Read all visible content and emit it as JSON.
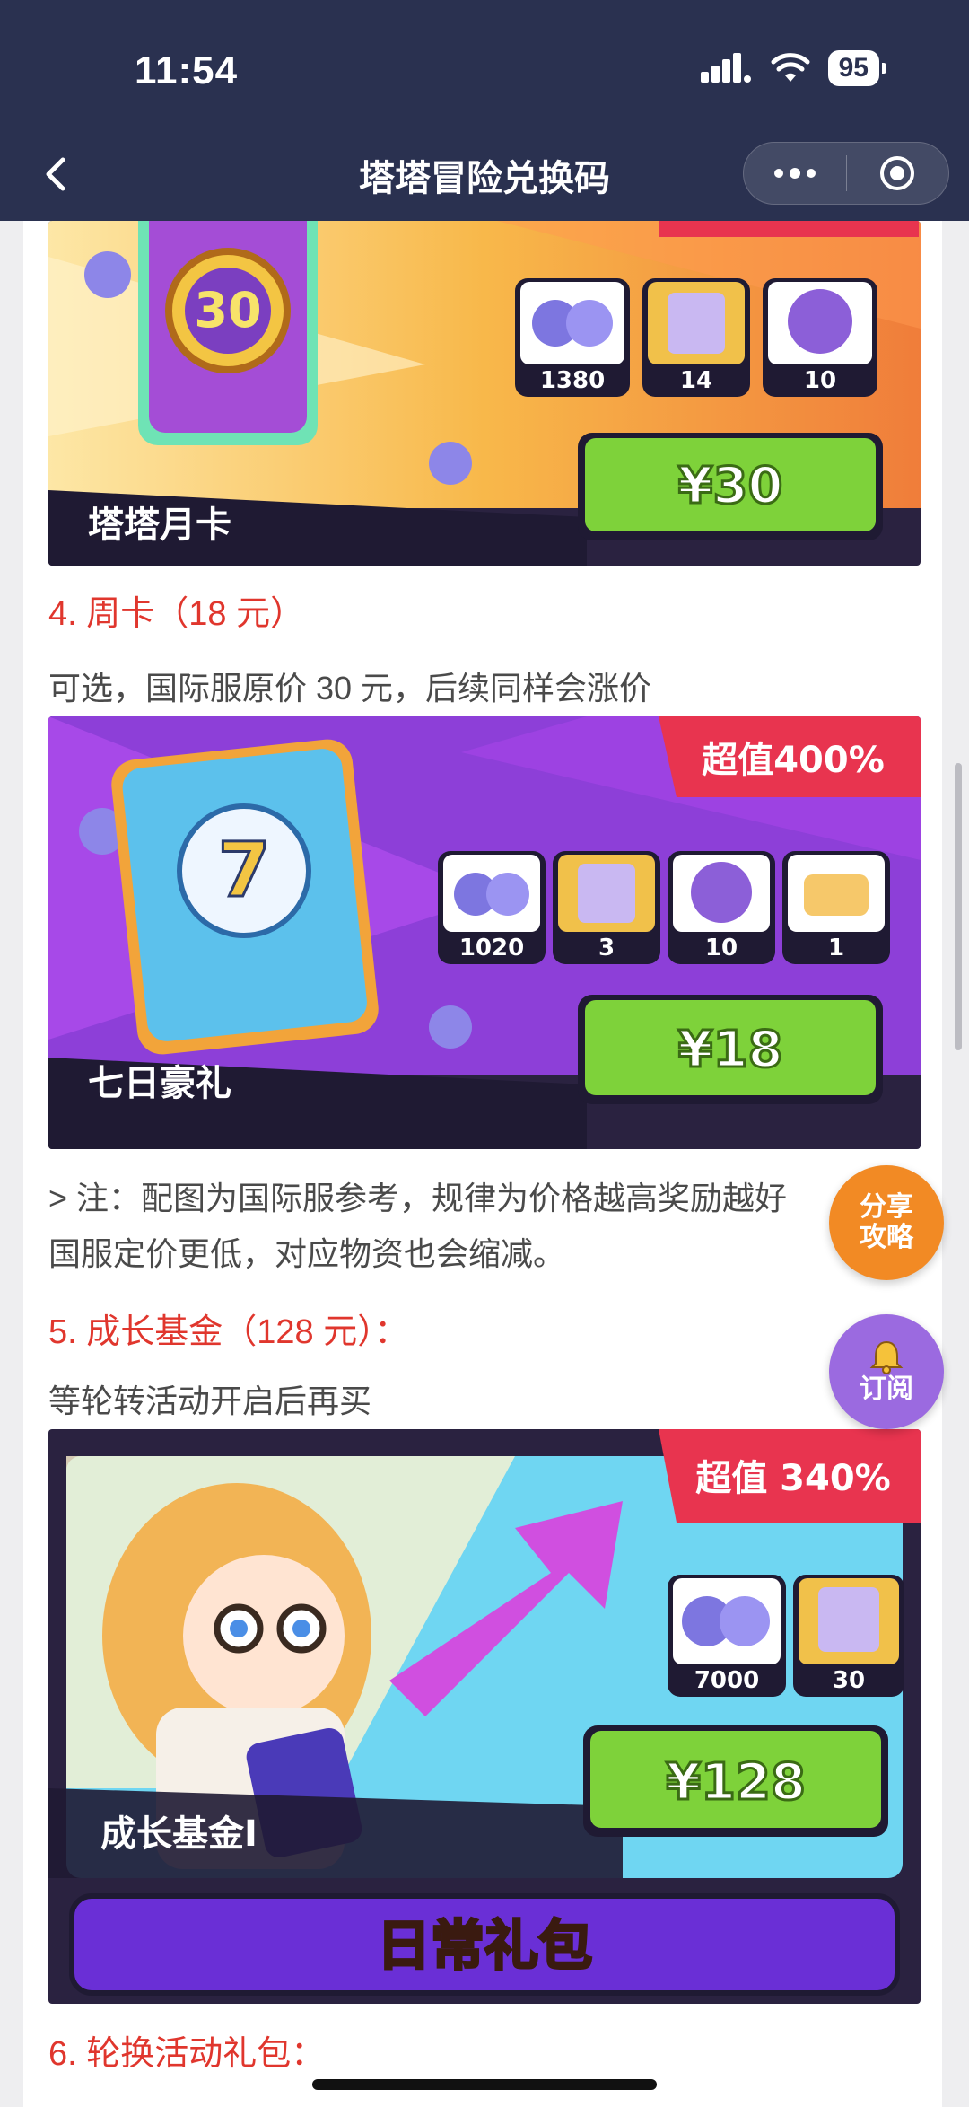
{
  "status_bar": {
    "time": "11:54",
    "battery": "95"
  },
  "nav": {
    "title": "塔塔冒险兑换码"
  },
  "banners": {
    "monthly": {
      "card_number": "30",
      "name": "塔塔月卡",
      "price": "¥30",
      "items": [
        "1380",
        "14",
        "10"
      ]
    },
    "weekly": {
      "badge": "超值400%",
      "card_number": "7",
      "name": "七日豪礼",
      "price": "¥18",
      "items": [
        "1020",
        "3",
        "10",
        "1"
      ]
    },
    "growth": {
      "badge": "超值 340%",
      "name": "成长基金I",
      "price": "¥128",
      "items": [
        "7000",
        "30"
      ],
      "footer": "日常礼包"
    }
  },
  "sections": {
    "h4": "4. 周卡（18 元）",
    "p4": "可选，国际服原价 30 元，后续同样会涨价",
    "note_line1": "> 注：配图为国际服参考，规律为价格越高奖励越好",
    "note_line2": "国服定价更低，对应物资也会缩减。",
    "h5": "5. 成长基金（128 元）：",
    "p5": "等轮转活动开启后再买",
    "h6": "6. 轮换活动礼包："
  },
  "fabs": {
    "share": [
      "分享",
      "攻略"
    ],
    "subscribe": "订阅"
  },
  "colors": {
    "nav_bg": "#2a3150",
    "heading_red": "#e0362d",
    "price_green": "#7ed23a",
    "fab_orange": "#f28a24",
    "fab_purple": "#9b6ae0"
  }
}
